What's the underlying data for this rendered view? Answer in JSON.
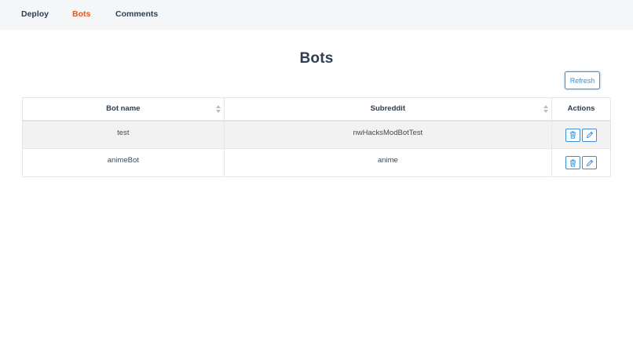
{
  "nav": {
    "items": [
      {
        "label": "Deploy",
        "active": false
      },
      {
        "label": "Bots",
        "active": true
      },
      {
        "label": "Comments",
        "active": false
      }
    ]
  },
  "page": {
    "title": "Bots",
    "refresh_label": "Refresh"
  },
  "table": {
    "columns": [
      "Bot name",
      "Subreddit",
      "Actions"
    ],
    "rows": [
      {
        "name": "test",
        "subreddit": "nwHacksModBotTest",
        "actions": [
          "trash-icon",
          "pencil-icon"
        ]
      },
      {
        "name": "animeBot",
        "subreddit": "anime",
        "actions": [
          "trash-icon",
          "pencil-icon"
        ]
      }
    ]
  },
  "colors": {
    "accent": "#e8541d",
    "primary_blue": "#3a8fd8",
    "text": "#2c3e50",
    "navbar_bg": "#f5f6f8",
    "stripe": "#f2f2f2"
  }
}
